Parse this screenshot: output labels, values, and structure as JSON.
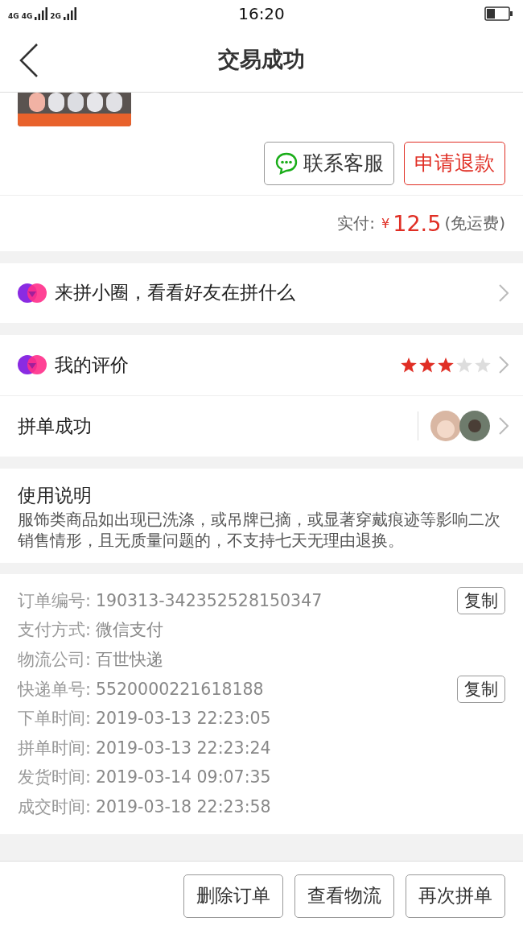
{
  "status_bar": {
    "networks": [
      "4G",
      "4G",
      "2G"
    ],
    "time": "16:20"
  },
  "nav": {
    "title": "交易成功"
  },
  "order_actions": [
    {
      "label": "联系客服",
      "kind": "chat"
    },
    {
      "label": "申请退款",
      "kind": "primary"
    }
  ],
  "payment": {
    "label": "实付:",
    "currency": "¥",
    "amount": "12.5",
    "note": "(免运费)"
  },
  "circle_link": {
    "label": "来拼小圈，看看好友在拼什么"
  },
  "review": {
    "label": "我的评价",
    "stars": 3
  },
  "group": {
    "label": "拼单成功"
  },
  "notice": {
    "title": "使用说明",
    "text": "服饰类商品如出现已洗涤，或吊牌已摘，或显著穿戴痕迹等影响二次销售情形，且无质量问题的，不支持七天无理由退换。"
  },
  "details": [
    {
      "label": "订单编号:",
      "value": "190313-342352528150347",
      "action": "复制"
    },
    {
      "label": "支付方式:",
      "value": "微信支付"
    },
    {
      "label": "物流公司:",
      "value": "百世快递"
    },
    {
      "label": "快递单号:",
      "value": "5520000221618188",
      "action": "复制"
    },
    {
      "label": "下单时间:",
      "value": "2019-03-13 22:23:05"
    },
    {
      "label": "拼单时间:",
      "value": "2019-03-13 22:23:24"
    },
    {
      "label": "发货时间:",
      "value": "2019-03-14 09:07:35"
    },
    {
      "label": "成交时间:",
      "value": "2019-03-18 22:23:58"
    }
  ],
  "bottom_actions": [
    "删除订单",
    "查看物流",
    "再次拼单"
  ]
}
